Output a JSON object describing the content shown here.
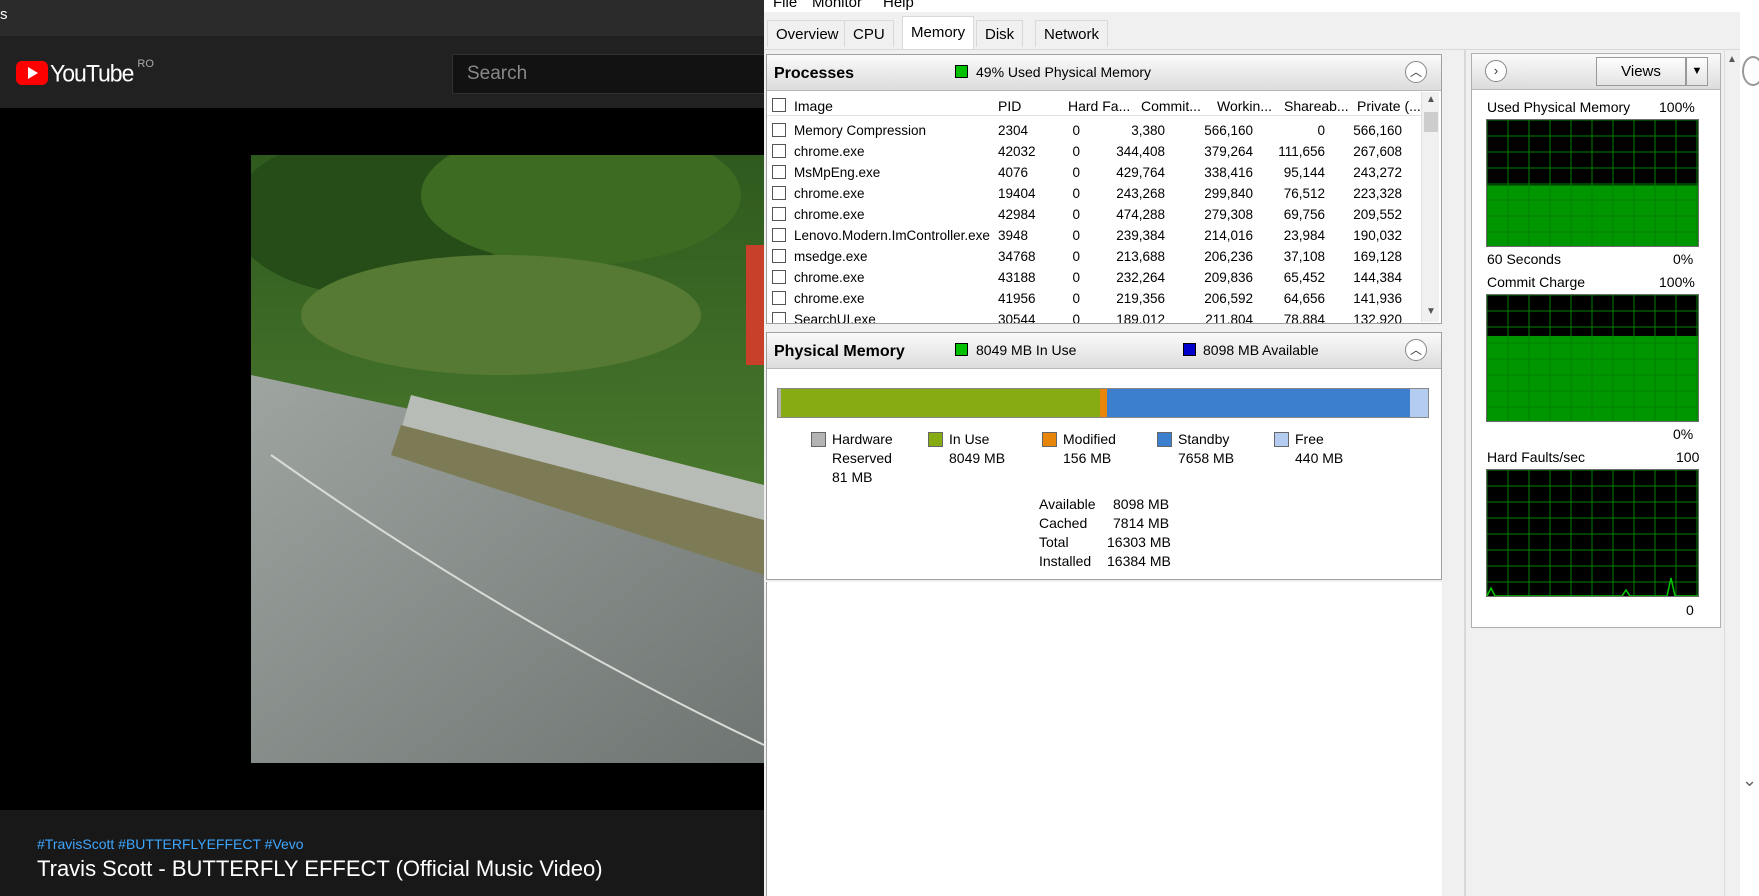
{
  "youtube": {
    "tab_fragment": "s",
    "logo_text": "YouTube",
    "country_code": "RO",
    "search_placeholder": "Search",
    "hashtags": "#TravisScott #BUTTERFLYEFFECT #Vevo",
    "video_title": "Travis Scott - BUTTERFLY EFFECT (Official Music Video)"
  },
  "resmon": {
    "menu": [
      "File",
      "Monitor",
      "Help"
    ],
    "tabs": [
      "Overview",
      "CPU",
      "Memory",
      "Disk",
      "Network"
    ],
    "active_tab": "Memory",
    "processes": {
      "title": "Processes",
      "status": "49% Used Physical Memory",
      "columns": [
        "Image",
        "PID",
        "Hard Fa...",
        "Commit...",
        "Workin...",
        "Shareab...",
        "Private (..."
      ],
      "rows": [
        [
          "Memory Compression",
          "2304",
          "0",
          "3,380",
          "566,160",
          "0",
          "566,160"
        ],
        [
          "chrome.exe",
          "42032",
          "0",
          "344,408",
          "379,264",
          "111,656",
          "267,608"
        ],
        [
          "MsMpEng.exe",
          "4076",
          "0",
          "429,764",
          "338,416",
          "95,144",
          "243,272"
        ],
        [
          "chrome.exe",
          "19404",
          "0",
          "243,268",
          "299,840",
          "76,512",
          "223,328"
        ],
        [
          "chrome.exe",
          "42984",
          "0",
          "474,288",
          "279,308",
          "69,756",
          "209,552"
        ],
        [
          "Lenovo.Modern.ImController.exe",
          "3948",
          "0",
          "239,384",
          "214,016",
          "23,984",
          "190,032"
        ],
        [
          "msedge.exe",
          "34768",
          "0",
          "213,688",
          "206,236",
          "37,108",
          "169,128"
        ],
        [
          "chrome.exe",
          "43188",
          "0",
          "232,264",
          "209,836",
          "65,452",
          "144,384"
        ],
        [
          "chrome.exe",
          "41956",
          "0",
          "219,356",
          "206,592",
          "64,656",
          "141,936"
        ],
        [
          "SearchUI.exe",
          "30544",
          "0",
          "189,012",
          "211,804",
          "78,884",
          "132,920"
        ]
      ]
    },
    "physical_memory": {
      "title": "Physical Memory",
      "in_use_label": "8049 MB In Use",
      "available_label": "8098 MB Available",
      "bar_fractions": {
        "hardware_reserved": 0.005,
        "in_use": 0.491,
        "modified": 0.0095,
        "standby": 0.467,
        "free": 0.027
      },
      "legend": [
        {
          "name": "Hardware\nReserved",
          "value": "81 MB",
          "color": "#b4b4b4"
        },
        {
          "name": "In Use",
          "value": "8049 MB",
          "color": "#87ab12"
        },
        {
          "name": "Modified",
          "value": "156 MB",
          "color": "#e8860c"
        },
        {
          "name": "Standby",
          "value": "7658 MB",
          "color": "#3d7fcf"
        },
        {
          "name": "Free",
          "value": "440 MB",
          "color": "#b3ccf0"
        }
      ],
      "stats": [
        {
          "label": "Available",
          "value": "8098 MB"
        },
        {
          "label": "Cached",
          "value": "7814 MB"
        },
        {
          "label": "Total",
          "value": "16303 MB"
        },
        {
          "label": "Installed",
          "value": "16384 MB"
        }
      ]
    },
    "graphs": {
      "views_label": "Views",
      "used_physical_memory": {
        "title": "Used Physical Memory",
        "max": "100%",
        "bottom_left": "60 Seconds",
        "bottom_right": "0%",
        "level": 0.49
      },
      "commit_charge": {
        "title": "Commit Charge",
        "max": "100%",
        "bottom_right": "0%",
        "level": 0.68
      },
      "hard_faults": {
        "title": "Hard Faults/sec",
        "max": "100",
        "bottom_right": "0"
      }
    },
    "colors": {
      "graph_green": "#00c800",
      "grid_green": "#008000",
      "in_use_square": "#00c000",
      "available_square": "#0000cc"
    }
  }
}
